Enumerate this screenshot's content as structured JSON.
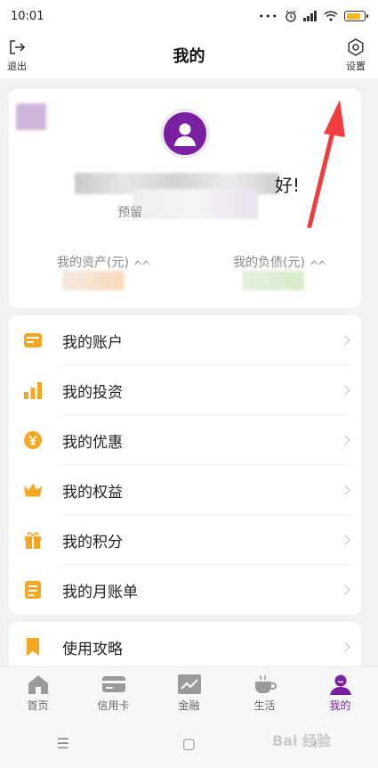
{
  "status_bar": {
    "time": "10:01"
  },
  "header": {
    "title": "我的",
    "logout_label": "退出",
    "settings_label": "设置"
  },
  "profile": {
    "greeting_tail": "好!",
    "sub_label_prefix": "预留",
    "assets_label": "我的资产(元)",
    "liabilities_label": "我的负债(元)"
  },
  "menu": {
    "items": [
      {
        "label": "我的账户",
        "icon": "card-icon"
      },
      {
        "label": "我的投资",
        "icon": "bar-chart-icon"
      },
      {
        "label": "我的优惠",
        "icon": "yen-coin-icon"
      },
      {
        "label": "我的权益",
        "icon": "crown-icon"
      },
      {
        "label": "我的积分",
        "icon": "gift-icon"
      },
      {
        "label": "我的月账单",
        "icon": "bill-icon"
      }
    ],
    "second_items": [
      {
        "label": "使用攻略",
        "icon": "bookmark-icon"
      }
    ]
  },
  "bottom_nav": {
    "items": [
      {
        "label": "首页",
        "icon": "home-icon"
      },
      {
        "label": "信用卡",
        "icon": "credit-card-icon"
      },
      {
        "label": "金融",
        "icon": "trend-icon"
      },
      {
        "label": "生活",
        "icon": "coffee-icon"
      },
      {
        "label": "我的",
        "icon": "user-icon"
      }
    ],
    "active_index": 4
  },
  "watermark": "Bai 经验",
  "colors": {
    "accent": "#7a1fa2",
    "icon_yellow": "#f5a623",
    "annotation_red": "#f03c3c"
  }
}
